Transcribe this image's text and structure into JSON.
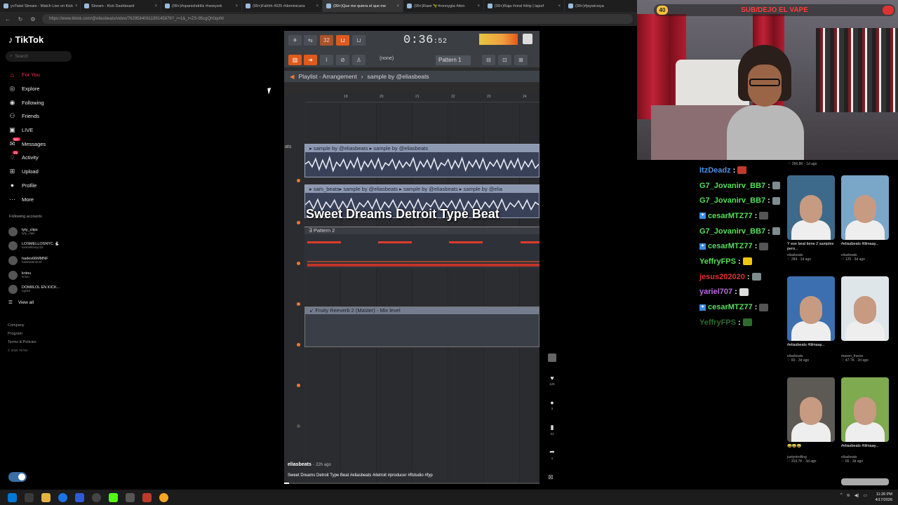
{
  "browser": {
    "tabs": [
      {
        "label": "yoTwist Stream - Watch Live on Kick",
        "active": false
      },
      {
        "label": "Stream - Kick Dashboard",
        "active": false
      },
      {
        "label": "(99+)#spanishdrillz #newyork",
        "active": false
      },
      {
        "label": "(99+)Fahhh #025 #dominicans",
        "active": false
      },
      {
        "label": "(99+)Que me quiera el que me",
        "active": true
      },
      {
        "label": "(99+)Rawr 🦖#ronnygta #don",
        "active": false
      },
      {
        "label": "(99+)Raja #viral #drip | lajsof",
        "active": false
      },
      {
        "label": "(99+)#jaywicwya",
        "active": false
      }
    ],
    "url": "https://www.tiktok.com/@eliasbeats/video/7629584081189145876?_r=1&_t=ZS-95cgQh0qvNl"
  },
  "tiktok": {
    "logo": "TikTok",
    "search_placeholder": "Search",
    "nav": [
      {
        "label": "For You",
        "icon": "home-icon",
        "glyph": "⌂"
      },
      {
        "label": "Explore",
        "icon": "compass-icon",
        "glyph": "◎"
      },
      {
        "label": "Following",
        "icon": "following-icon",
        "glyph": "◉"
      },
      {
        "label": "Friends",
        "icon": "friends-icon",
        "glyph": "⚇"
      },
      {
        "label": "LIVE",
        "icon": "live-icon",
        "glyph": "▣"
      },
      {
        "label": "Messages",
        "icon": "messages-icon",
        "glyph": "✉",
        "badge": "99+"
      },
      {
        "label": "Activity",
        "icon": "activity-icon",
        "glyph": "♢",
        "badge": "21"
      },
      {
        "label": "Upload",
        "icon": "upload-icon",
        "glyph": "⊞"
      },
      {
        "label": "Profile",
        "icon": "profile-icon",
        "glyph": "●"
      },
      {
        "label": "More",
        "icon": "more-icon",
        "glyph": "⋯"
      }
    ],
    "following_title": "Following accounts",
    "following": [
      {
        "name": "tyty_clips",
        "handle": "tyty_clips"
      },
      {
        "name": "LOSMELLOSNYC 🐇",
        "handle": "losmellosnyc22"
      },
      {
        "name": "hades66MMNF",
        "handle": "hades66mmnf"
      },
      {
        "name": "kriiou",
        "handle": "kriiou"
      },
      {
        "name": "DOMIILOL EN KICK...",
        "handle": "ogrilol"
      }
    ],
    "view_all": "View all",
    "footer": [
      "Company",
      "Program",
      "Terms & Policies"
    ],
    "copyright": "© 2026 TikTok"
  },
  "video": {
    "author": "eliasbeats",
    "age": "22h ago",
    "description": "Sweet Dreams Detroit Type Beat #eliasbeats #detroit #producer #flstudio #fyp",
    "caption": "Sweet Dreams Detroit Type Beat",
    "progress": 0.02,
    "actions": [
      {
        "icon": "heart-icon",
        "glyph": "♥",
        "count": "121"
      },
      {
        "icon": "comment-icon",
        "glyph": "●",
        "count": "2"
      },
      {
        "icon": "bookmark-icon",
        "glyph": "▮",
        "count": "21"
      },
      {
        "icon": "share-icon",
        "glyph": "➦",
        "count": "1"
      }
    ],
    "fl": {
      "time": "0:36",
      "time_small": ":52",
      "pattern": "Pattern 1",
      "none": "(none)",
      "breadcrumb": "Playlist - Arrangement",
      "breadcrumb_sub": "sample by @eliasbeats",
      "ruler": [
        "19",
        "20",
        "21",
        "22",
        "23",
        "24"
      ],
      "clip1": "▸ sample by @eliasbeats        ▸ sample by @eliasbeats",
      "clip2": "▸ sam_beats▸ sample by @eliasbeats ▸ sample by @eliasbeats ▸ sample by @elia",
      "pattern2": "∃ Pattern 2",
      "reverb": "↙ Fruity Reeverb 2 (Master) - Mix level",
      "track_label": "ats"
    }
  },
  "stream": {
    "banner": "SUB/DEJO EL VAPE",
    "badge": "40"
  },
  "chat": [
    {
      "user": "ItzDeadz",
      "color": "#4a90e2",
      "badge": false
    },
    {
      "user": "G7_Jovanirv_BB7",
      "color": "#53e05a",
      "badge": false
    },
    {
      "user": "G7_Jovanirv_BB7",
      "color": "#53e05a",
      "badge": false
    },
    {
      "user": "cesarMTZ77",
      "color": "#53e05a",
      "badge": true
    },
    {
      "user": "G7_Jovanirv_BB7",
      "color": "#53e05a",
      "badge": false
    },
    {
      "user": "cesarMTZ77",
      "color": "#53e05a",
      "badge": true
    },
    {
      "user": "YeffryFPS",
      "color": "#53e05a",
      "badge": false
    },
    {
      "user": "jesus202020",
      "color": "#e03030",
      "badge": false
    },
    {
      "user": "yariel707",
      "color": "#b86be0",
      "badge": false
    },
    {
      "user": "cesarMTZ77",
      "color": "#53e05a",
      "badge": true
    },
    {
      "user": "YeffryFPS",
      "color": "#2d6b2d",
      "badge": false
    }
  ],
  "videos": [
    {
      "top_stats": "♡ 266.8K · 1d ago"
    },
    {
      "title": "Y ese beat tiene 2 samples pero...",
      "author": "eliasbeats",
      "stats": "♡ 284 · 1d ago"
    },
    {
      "title": "#eliasbeats #lilmaay...",
      "author": "eliasbeats",
      "stats": "♡ 125 · 3d ago"
    },
    {
      "title": "#eliasbeats #lilmaay...",
      "author": "eliasbeats",
      "stats": "♡ 60 · 3d ago"
    },
    {
      "title": "",
      "author": "mason_fraces",
      "stats": "♡ 47.7K · 2d ago"
    },
    {
      "title": "😂😂😂",
      "author": "justyntrolling",
      "stats": "♡ 319.7K · 3d ago"
    },
    {
      "title": "#eliasbeats #lilmaay...",
      "author": "eliasbeats",
      "stats": "♡ 56 · 3d ago"
    }
  ],
  "taskbar": {
    "time": "11:26 PM",
    "date": "4/17/2026"
  },
  "colors": {
    "tiktok_red": "#fe2c55",
    "fl_orange": "#e05a1b",
    "clip_blue": "#6a7690"
  }
}
